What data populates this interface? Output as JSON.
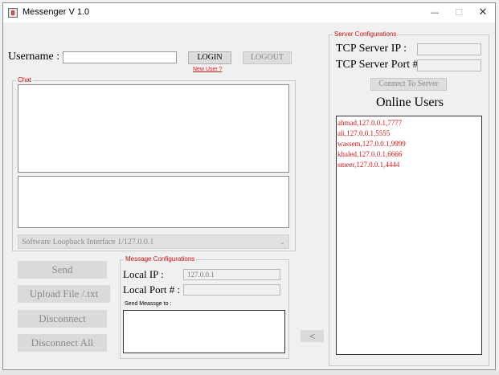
{
  "window": {
    "title": "Messenger V 1.0",
    "min_symbol": "—",
    "max_symbol": "☐",
    "close_symbol": "✕"
  },
  "login": {
    "username_label": "Username :",
    "username_value": "",
    "login_label": "LOGIN",
    "logout_label": "LOGOUT",
    "new_user_link": "New User ?"
  },
  "chat": {
    "group_title": "Chat",
    "history_text": "",
    "compose_text": "",
    "interface_selected": "Software Loopback Interface 1/127.0.0.1"
  },
  "actions": {
    "send": "Send",
    "upload": "Upload File /.txt",
    "disconnect": "Disconnect",
    "disconnect_all": "Disconnect All",
    "arrow": "<"
  },
  "message_config": {
    "group_title": "Message Configurations",
    "local_ip_label": "Local IP :",
    "local_ip_value": "127.0.0.1",
    "local_port_label": "Local Port # :",
    "local_port_value": "",
    "send_to_label": "Send Meassge to :",
    "send_to_value": ""
  },
  "server_config": {
    "group_title": "Server Configurations",
    "ip_label": "TCP Server IP :",
    "ip_value": "",
    "port_label": "TCP Server Port # :",
    "port_value": "",
    "connect_label": "Connect To Server"
  },
  "online_users": {
    "title": "Online Users",
    "users": [
      "ahmad,127.0.0.1,7777",
      "ali,127.0.0.1,5555",
      "wassem,127.0.0.1,9999",
      "khaled,127.0.0.1,6666",
      "smeer,127.0.0.1,4444"
    ]
  },
  "colors": {
    "accent_red": "#d01010",
    "window_bg": "#f0f0f0"
  }
}
